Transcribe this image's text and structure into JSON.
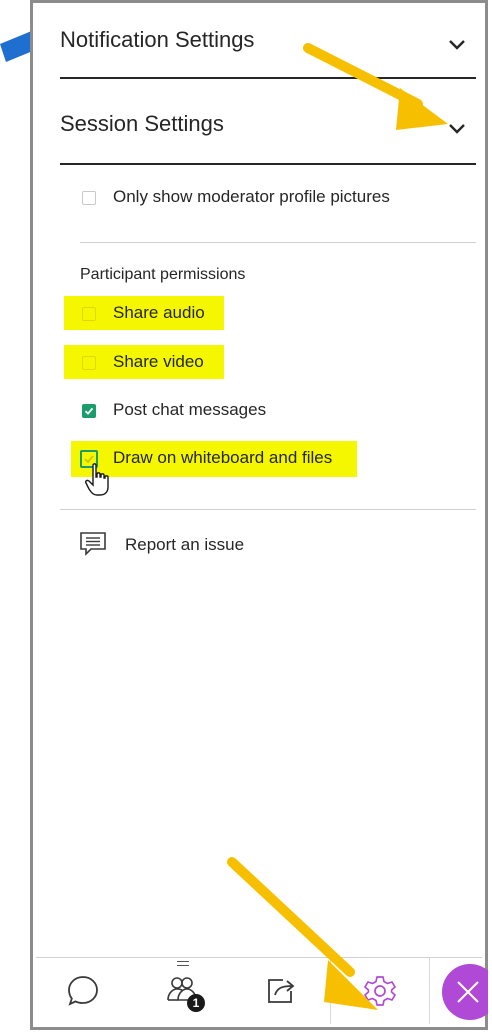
{
  "sections": {
    "notification_title": "Notification Settings",
    "session_title": "Session Settings"
  },
  "options": {
    "moderator_pictures": {
      "label": "Only show moderator profile pictures",
      "checked": false
    },
    "participant_header": "Participant permissions",
    "permissions": [
      {
        "label": "Share audio",
        "checked": false
      },
      {
        "label": "Share video",
        "checked": false
      },
      {
        "label": "Post chat messages",
        "checked": true
      },
      {
        "label": "Draw on whiteboard and files",
        "checked": true
      }
    ]
  },
  "report": {
    "label": "Report an issue"
  },
  "tabs": {
    "badge": "1"
  },
  "colors": {
    "highlight": "#f4f700",
    "checkbox_checked": "#1a9c6b",
    "arrow_yellow": "#f6c000",
    "arrow_blue": "#1f6fd0",
    "settings_purple": "#b04ad6"
  }
}
